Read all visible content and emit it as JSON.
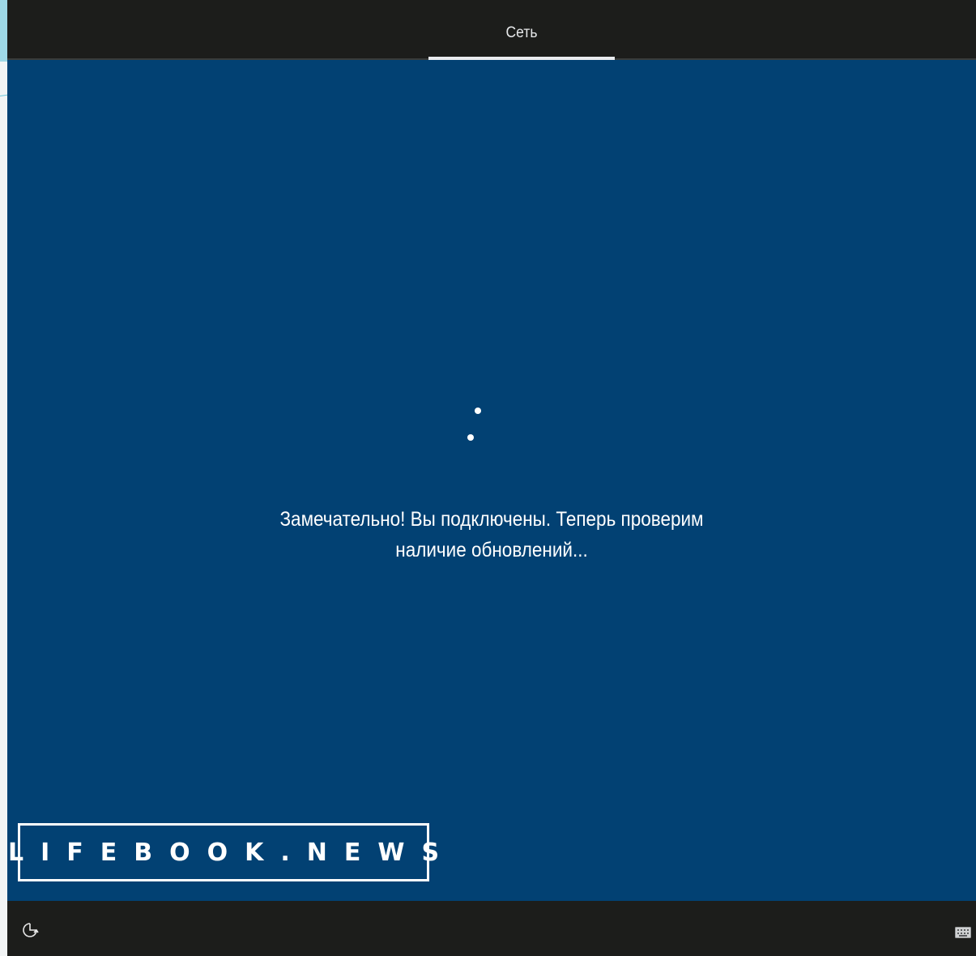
{
  "header": {
    "tabs": [
      {
        "label": "Сеть",
        "active": true
      }
    ]
  },
  "main": {
    "message_line1": "Замечательно! Вы подключены. Теперь проверим",
    "message_line2": "наличие обновлений..."
  },
  "watermark": {
    "text": "LIFEBOOK.NEWS"
  },
  "footer": {
    "left_icon": "accessibility-icon",
    "right_icon": "keyboard-icon"
  },
  "colors": {
    "background": "#024173",
    "bars": "#1c1d1b",
    "text": "#ffffff"
  }
}
